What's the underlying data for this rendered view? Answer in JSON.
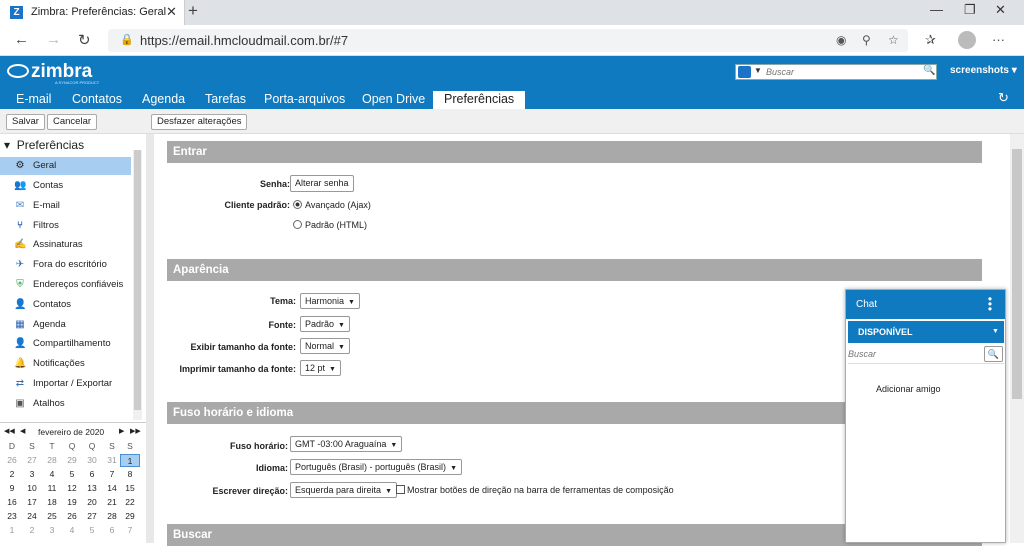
{
  "browser": {
    "tab_title": "Zimbra: Preferências: Geral",
    "favicon": "Z",
    "close": "✕",
    "new_tab": "+",
    "url": "https://email.hmcloudmail.com.br/#7",
    "win_min": "—",
    "win_max": "❐",
    "win_close": "✕"
  },
  "header": {
    "logo": "zimbra",
    "logo_sub": "A SYNACOR PRODUCT",
    "search_placeholder": "Buscar",
    "user": "screenshots ▾",
    "tabs": [
      "E-mail",
      "Contatos",
      "Agenda",
      "Tarefas",
      "Porta-arquivos",
      "Open Drive",
      "Preferências"
    ]
  },
  "toolbar": {
    "save": "Salvar",
    "cancel": "Cancelar",
    "undo": "Desfazer alterações"
  },
  "sidebar": {
    "header": "Preferências",
    "items": [
      {
        "label": "Geral",
        "icon": "gear-icon",
        "glyph": "⚙"
      },
      {
        "label": "Contas",
        "icon": "accounts-icon",
        "glyph": "👥"
      },
      {
        "label": "E-mail",
        "icon": "mail-icon",
        "glyph": "✉"
      },
      {
        "label": "Filtros",
        "icon": "filter-icon",
        "glyph": "⑂"
      },
      {
        "label": "Assinaturas",
        "icon": "signature-icon",
        "glyph": "✍"
      },
      {
        "label": "Fora do escritório",
        "icon": "out-of-office-icon",
        "glyph": "✈"
      },
      {
        "label": "Endereços confiáveis",
        "icon": "shield-icon",
        "glyph": "⛨"
      },
      {
        "label": "Contatos",
        "icon": "contact-icon",
        "glyph": "👤"
      },
      {
        "label": "Agenda",
        "icon": "calendar-icon",
        "glyph": "▦"
      },
      {
        "label": "Compartilhamento",
        "icon": "share-icon",
        "glyph": "👤"
      },
      {
        "label": "Notificações",
        "icon": "bell-icon",
        "glyph": "🔔"
      },
      {
        "label": "Importar / Exportar",
        "icon": "import-export-icon",
        "glyph": "⇄"
      },
      {
        "label": "Atalhos",
        "icon": "shortcut-icon",
        "glyph": "▣"
      }
    ]
  },
  "calendar": {
    "month": "fevereiro de 2020",
    "weekdays": [
      "D",
      "S",
      "T",
      "Q",
      "Q",
      "S",
      "S"
    ],
    "rows": [
      [
        "26",
        "27",
        "28",
        "29",
        "30",
        "31",
        "1"
      ],
      [
        "2",
        "3",
        "4",
        "5",
        "6",
        "7",
        "8"
      ],
      [
        "9",
        "10",
        "11",
        "12",
        "13",
        "14",
        "15"
      ],
      [
        "16",
        "17",
        "18",
        "19",
        "20",
        "21",
        "22"
      ],
      [
        "23",
        "24",
        "25",
        "26",
        "27",
        "28",
        "29"
      ],
      [
        "1",
        "2",
        "3",
        "4",
        "5",
        "6",
        "7"
      ]
    ]
  },
  "sections": {
    "entrar": {
      "title": "Entrar",
      "senha_label": "Senha:",
      "senha_button": "Alterar senha",
      "cliente_label": "Cliente padrão:",
      "opt_ajax": "Avançado (Ajax)",
      "opt_html": "Padrão (HTML)"
    },
    "aparencia": {
      "title": "Aparência",
      "tema_label": "Tema:",
      "tema_value": "Harmonia",
      "fonte_label": "Fonte:",
      "fonte_value": "Padrão",
      "exibir_label": "Exibir tamanho da fonte:",
      "exibir_value": "Normal",
      "imprimir_label": "Imprimir tamanho da fonte:",
      "imprimir_value": "12 pt"
    },
    "fuso": {
      "title": "Fuso horário e idioma",
      "fuso_label": "Fuso horário:",
      "fuso_value": "GMT -03:00 Araguaína",
      "idioma_label": "Idioma:",
      "idioma_value": "Português (Brasil) - português (Brasil)",
      "direcao_label": "Escrever direção:",
      "direcao_value": "Esquerda para direita",
      "mostrar_label": "Mostrar botões de direção na barra de ferramentas de composição"
    },
    "buscar": {
      "title": "Buscar"
    }
  },
  "chat": {
    "title": "Chat",
    "status": "DISPONÍVEL",
    "search_placeholder": "Buscar",
    "add_friend": "Adicionar amigo"
  },
  "colors": {
    "brand": "#0f7ac0",
    "section_bar": "#a9a9a9",
    "selected": "#a7cdf0"
  }
}
